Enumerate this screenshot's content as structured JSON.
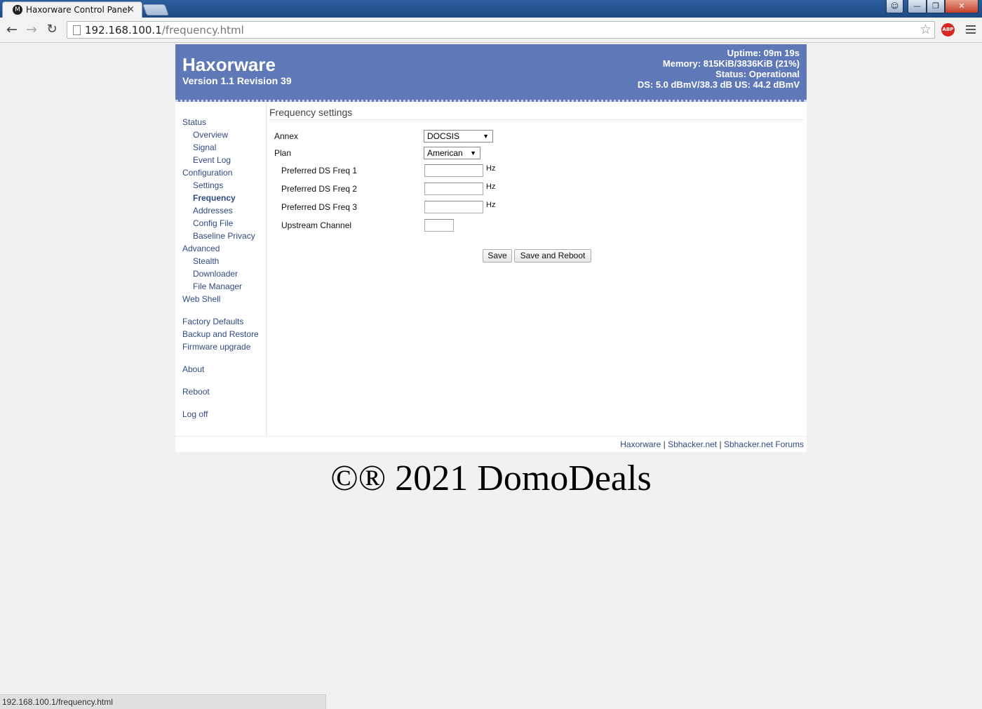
{
  "browser": {
    "tab_title": "Haxorware Control Panel",
    "tab_close": "×",
    "url_host": "192.168.100.1",
    "url_path": "/frequency.html",
    "status_url": "192.168.100.1/frequency.html",
    "abp_label": "ABP",
    "icons": [
      "back-arrow-icon",
      "forward-arrow-icon",
      "reload-icon",
      "page-icon",
      "star-icon",
      "adblock-icon",
      "menu-icon"
    ]
  },
  "header": {
    "brand": "Haxorware",
    "version": "Version 1.1 Revision 39",
    "uptime": "Uptime: 09m 19s",
    "memory": "Memory: 815KiB/3836KiB (21%)",
    "status": "Status: Operational",
    "signal": "DS: 5.0 dBmV/38.3 dB US: 44.2 dBmV",
    "background_color": "#5f78b8"
  },
  "sidebar": {
    "status": "Status",
    "overview": "Overview",
    "signal": "Signal",
    "event_log": "Event Log",
    "configuration": "Configuration",
    "settings": "Settings",
    "frequency": "Frequency",
    "addresses": "Addresses",
    "config_file": "Config File",
    "baseline_privacy": "Baseline Privacy",
    "advanced": "Advanced",
    "stealth": "Stealth",
    "downloader": "Downloader",
    "file_manager": "File Manager",
    "web_shell": "Web Shell",
    "factory_defaults": "Factory Defaults",
    "backup_restore": "Backup and Restore",
    "firmware_upgrade": "Firmware upgrade",
    "about": "About",
    "reboot": "Reboot",
    "log_off": "Log off",
    "active_item": "Frequency"
  },
  "form": {
    "title": "Frequency settings",
    "annex_label": "Annex",
    "annex_value": "DOCSIS",
    "plan_label": "Plan",
    "plan_value": "American",
    "ds_freq1_label": "Preferred DS Freq 1",
    "ds_freq1_value": "",
    "ds_freq2_label": "Preferred DS Freq 2",
    "ds_freq2_value": "",
    "ds_freq3_label": "Preferred DS Freq 3",
    "ds_freq3_value": "",
    "unit": "Hz",
    "upstream_label": "Upstream Channel",
    "upstream_value": "",
    "save_label": "Save",
    "save_reboot_label": "Save and Reboot"
  },
  "footer": {
    "link1": "Haxorware",
    "link2": "Sbhacker.net",
    "link3": "Sbhacker.net Forums",
    "separator": " | "
  },
  "watermark": "©® 2021 DomoDeals"
}
